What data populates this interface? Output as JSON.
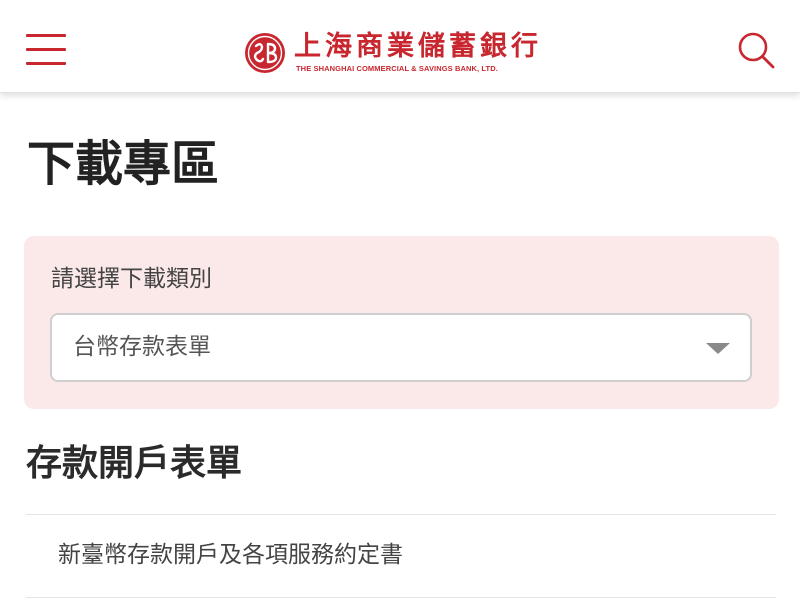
{
  "header": {
    "bank_name_zh": "上海商業儲蓄銀行",
    "bank_name_en": "THE SHANGHAI COMMERCIAL & SAVINGS BANK, LTD.",
    "menu_icon": "hamburger-menu-icon",
    "search_icon": "search-icon"
  },
  "page": {
    "title": "下載專區"
  },
  "filter": {
    "label": "請選擇下載類別",
    "selected_value": "台幣存款表單"
  },
  "section": {
    "title": "存款開戶表單",
    "items": [
      {
        "label": "新臺幣存款開戶及各項服務約定書"
      }
    ]
  },
  "colors": {
    "brand_red": "#c8272f",
    "filter_background": "#fbe9e9"
  }
}
